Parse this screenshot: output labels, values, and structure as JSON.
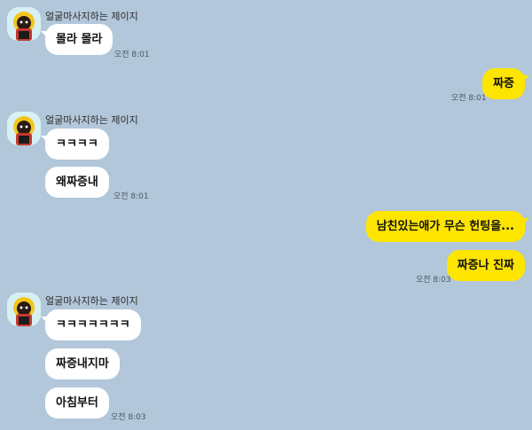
{
  "sender": {
    "name": "얼굴마사지하는 제이지",
    "avatar_icon": "ryan-character-icon"
  },
  "groups": [
    {
      "messages": [
        "몰라 몰라"
      ],
      "time": "오전 8:01"
    },
    {
      "messages": [
        "짜증"
      ],
      "time": "오전 8:01"
    },
    {
      "messages": [
        "ㅋㅋㅋㅋ",
        "왜짜증내"
      ],
      "time": "오전 8:01"
    },
    {
      "messages": [
        "남친있는애가 무슨 헌팅을...",
        "짜증나 진짜"
      ],
      "time": "오전 8:03"
    },
    {
      "messages": [
        "ㅋㅋㅋㅋㅋㅋㅋ",
        "짜증내지마",
        "아침부터"
      ],
      "time": "오전 8:03"
    }
  ],
  "colors": {
    "background": "#b2c7da",
    "incoming_bubble": "#ffffff",
    "outgoing_bubble": "#fee500",
    "avatar_bg": "#d7f0f4"
  }
}
